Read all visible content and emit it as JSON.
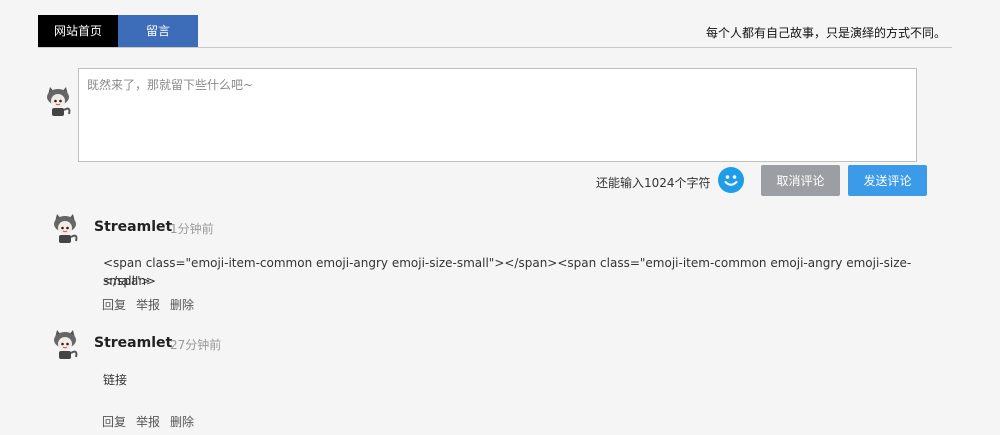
{
  "nav": {
    "tabs": [
      {
        "label": "网站首页"
      },
      {
        "label": "留言"
      }
    ],
    "slogan": "每个人都有自己故事，只是演绎的方式不同。"
  },
  "editor": {
    "placeholder": "既然来了，那就留下些什么吧~",
    "value": ""
  },
  "footer": {
    "counter_text": "还能输入1024个字符",
    "emoji_icon": "smile-icon",
    "cancel_label": "取消评论",
    "send_label": "发送评论"
  },
  "comments": [
    {
      "author": "Streamlet",
      "time": "1分钟前",
      "body_line1": "<span class=\"emoji-item-common emoji-angry emoji-size-small\"></span><span class=\"emoji-item-common emoji-angry emoji-size-small\">",
      "body_line2": "</span>",
      "actions": [
        "回复",
        "举报",
        "删除"
      ]
    },
    {
      "author": "Streamlet",
      "time": "27分钟前",
      "body_line1": "链接",
      "actions": [
        "回复",
        "举报",
        "删除"
      ]
    }
  ],
  "colors": {
    "home_tab": "#000000",
    "active_tab": "#3d6db8",
    "send_button": "#3c9be8",
    "cancel_button": "#9b9ea3",
    "emoji_button": "#1e9de8"
  }
}
